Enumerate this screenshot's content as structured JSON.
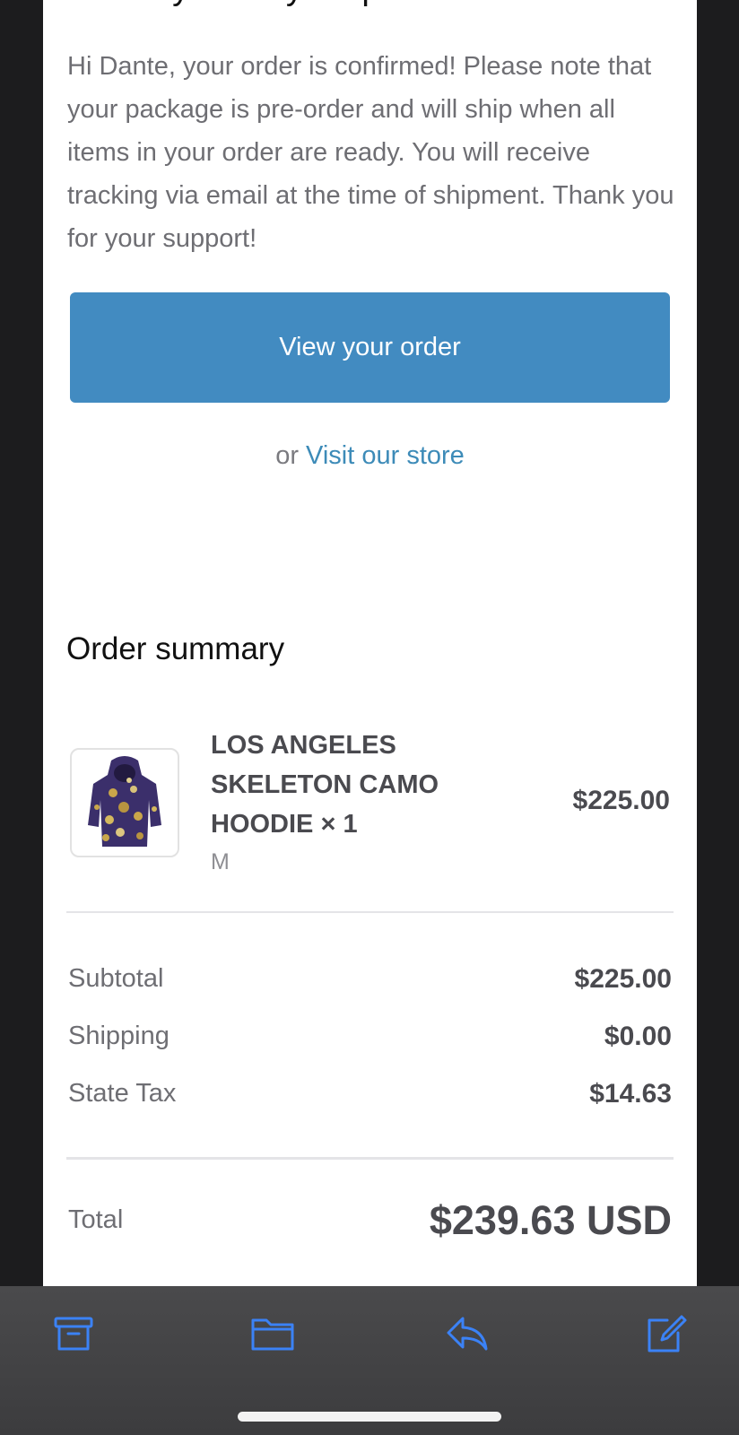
{
  "email": {
    "heading": "Thank you for your purchase!",
    "intro": "Hi Dante, your order is confirmed! Please note that your package is pre-order and will ship when all items in your order are ready. You will receive tracking via email at the time of shipment. Thank you for your support!",
    "view_order_label": "View your order",
    "or_text": "or",
    "visit_store_label": "Visit our store"
  },
  "summary": {
    "title": "Order summary",
    "items": [
      {
        "name": "LOS ANGELES SKELETON CAMO HOODIE × 1",
        "variant": "M",
        "price": "$225.00"
      }
    ],
    "rows": [
      {
        "label": "Subtotal",
        "value": "$225.00"
      },
      {
        "label": "Shipping",
        "value": "$0.00"
      },
      {
        "label": "State Tax",
        "value": "$14.63"
      }
    ],
    "total_label": "Total",
    "total_value": "$239.63 USD"
  },
  "toolbar": {
    "icons": [
      "archive-icon",
      "folder-icon",
      "reply-icon",
      "compose-icon"
    ]
  },
  "colors": {
    "accent": "#428bc1",
    "link": "#3d8bb8",
    "toolbar_icon": "#3b82f6",
    "background": "#1c1c1e"
  }
}
